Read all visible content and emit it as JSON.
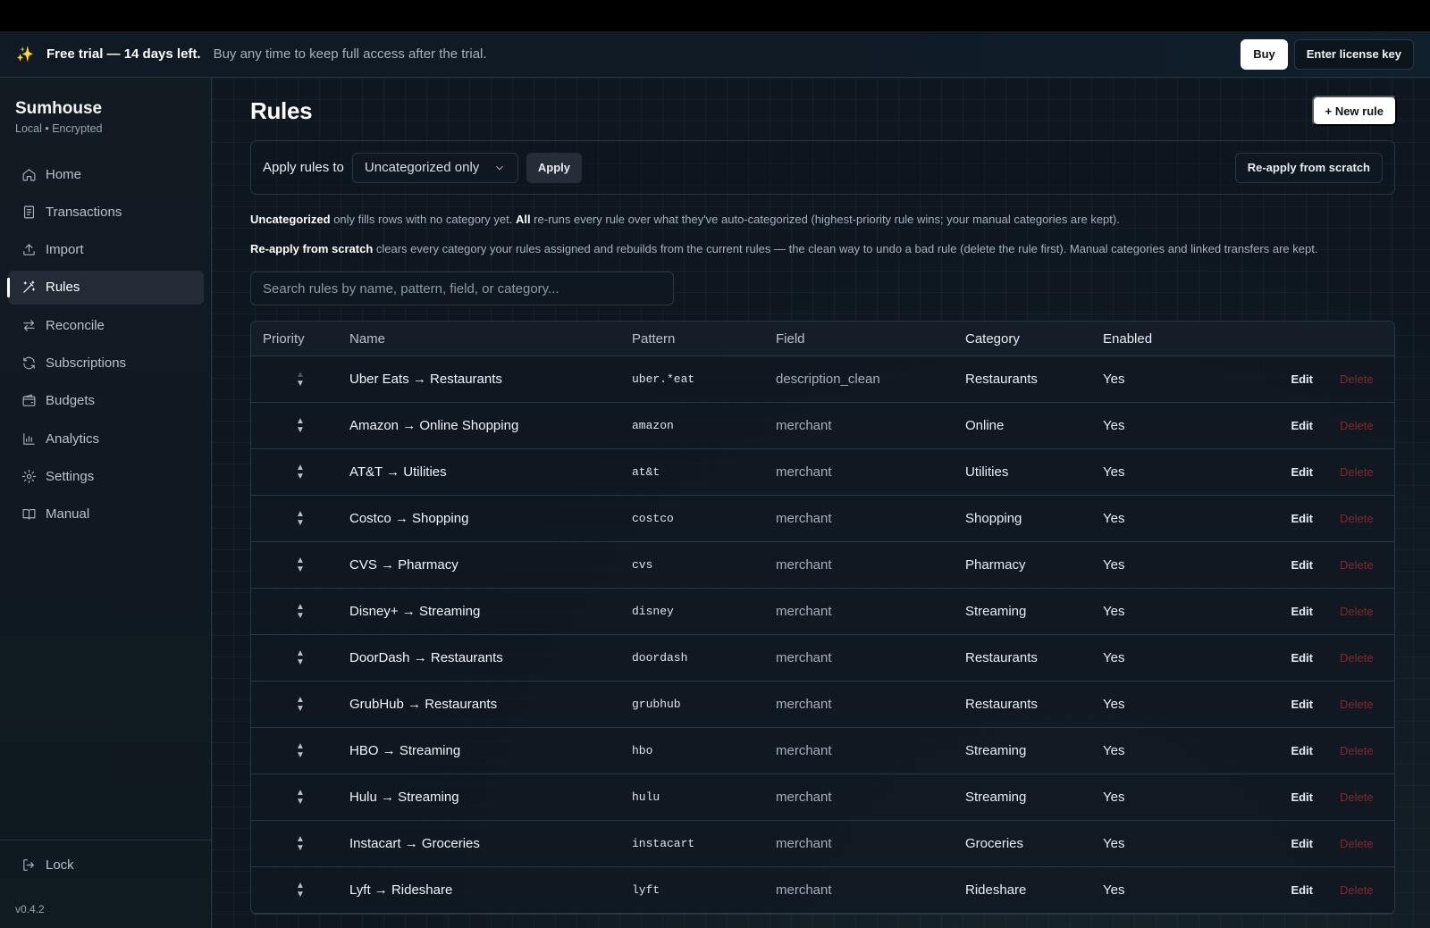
{
  "banner": {
    "sparkle": "✨",
    "title": "Free trial — 14 days left.",
    "subtitle": "Buy any time to keep full access after the trial.",
    "buy_label": "Buy",
    "license_label": "Enter license key"
  },
  "sidebar": {
    "brand": "Sumhouse",
    "brand_sub": "Local • Encrypted",
    "items": [
      {
        "label": "Home",
        "icon": "home-icon"
      },
      {
        "label": "Transactions",
        "icon": "receipt-icon"
      },
      {
        "label": "Import",
        "icon": "upload-icon"
      },
      {
        "label": "Rules",
        "icon": "wand-icon",
        "active": true
      },
      {
        "label": "Reconcile",
        "icon": "swap-icon"
      },
      {
        "label": "Subscriptions",
        "icon": "refresh-icon"
      },
      {
        "label": "Budgets",
        "icon": "wallet-icon"
      },
      {
        "label": "Analytics",
        "icon": "bar-chart-icon"
      },
      {
        "label": "Settings",
        "icon": "gear-icon"
      },
      {
        "label": "Manual",
        "icon": "book-icon"
      }
    ],
    "lock_label": "Lock",
    "version": "v0.4.2"
  },
  "main": {
    "title": "Rules",
    "new_rule_label": "+ New rule",
    "apply_label": "Apply rules to",
    "scope_value": "Uncategorized only",
    "apply_button": "Apply",
    "reapply_button": "Re-apply from scratch",
    "help1_b1": "Uncategorized",
    "help1_t1": " only fills rows with no category yet. ",
    "help1_b2": "All",
    "help1_t2": " re-runs every rule over what they've auto-categorized (highest-priority rule wins; your manual categories are kept).",
    "help2_b1": "Re-apply from scratch",
    "help2_t1": " clears every category your rules assigned and rebuilds from the current rules — the clean way to undo a bad rule (delete the rule first). Manual categories and linked transfers are kept.",
    "search_placeholder": "Search rules by name, pattern, field, or category..."
  },
  "table": {
    "headers": {
      "priority": "Priority",
      "name": "Name",
      "pattern": "Pattern",
      "field": "Field",
      "category": "Category",
      "enabled": "Enabled"
    },
    "edit_label": "Edit",
    "delete_label": "Delete",
    "rows": [
      {
        "name": "Uber Eats → Restaurants",
        "pattern": "uber.*eat",
        "field": "description_clean",
        "category": "Restaurants",
        "enabled": "Yes"
      },
      {
        "name": "Amazon → Online Shopping",
        "pattern": "amazon",
        "field": "merchant",
        "category": "Online",
        "enabled": "Yes"
      },
      {
        "name": "AT&T → Utilities",
        "pattern": "at&t",
        "field": "merchant",
        "category": "Utilities",
        "enabled": "Yes"
      },
      {
        "name": "Costco → Shopping",
        "pattern": "costco",
        "field": "merchant",
        "category": "Shopping",
        "enabled": "Yes"
      },
      {
        "name": "CVS → Pharmacy",
        "pattern": "cvs",
        "field": "merchant",
        "category": "Pharmacy",
        "enabled": "Yes"
      },
      {
        "name": "Disney+ → Streaming",
        "pattern": "disney",
        "field": "merchant",
        "category": "Streaming",
        "enabled": "Yes"
      },
      {
        "name": "DoorDash → Restaurants",
        "pattern": "doordash",
        "field": "merchant",
        "category": "Restaurants",
        "enabled": "Yes"
      },
      {
        "name": "GrubHub → Restaurants",
        "pattern": "grubhub",
        "field": "merchant",
        "category": "Restaurants",
        "enabled": "Yes"
      },
      {
        "name": "HBO → Streaming",
        "pattern": "hbo",
        "field": "merchant",
        "category": "Streaming",
        "enabled": "Yes"
      },
      {
        "name": "Hulu → Streaming",
        "pattern": "hulu",
        "field": "merchant",
        "category": "Streaming",
        "enabled": "Yes"
      },
      {
        "name": "Instacart → Groceries",
        "pattern": "instacart",
        "field": "merchant",
        "category": "Groceries",
        "enabled": "Yes"
      },
      {
        "name": "Lyft → Rideshare",
        "pattern": "lyft",
        "field": "merchant",
        "category": "Rideshare",
        "enabled": "Yes"
      }
    ]
  },
  "colors": {
    "accent": "#ffffff",
    "delete": "#7d2a31",
    "background": "#0e1720"
  }
}
